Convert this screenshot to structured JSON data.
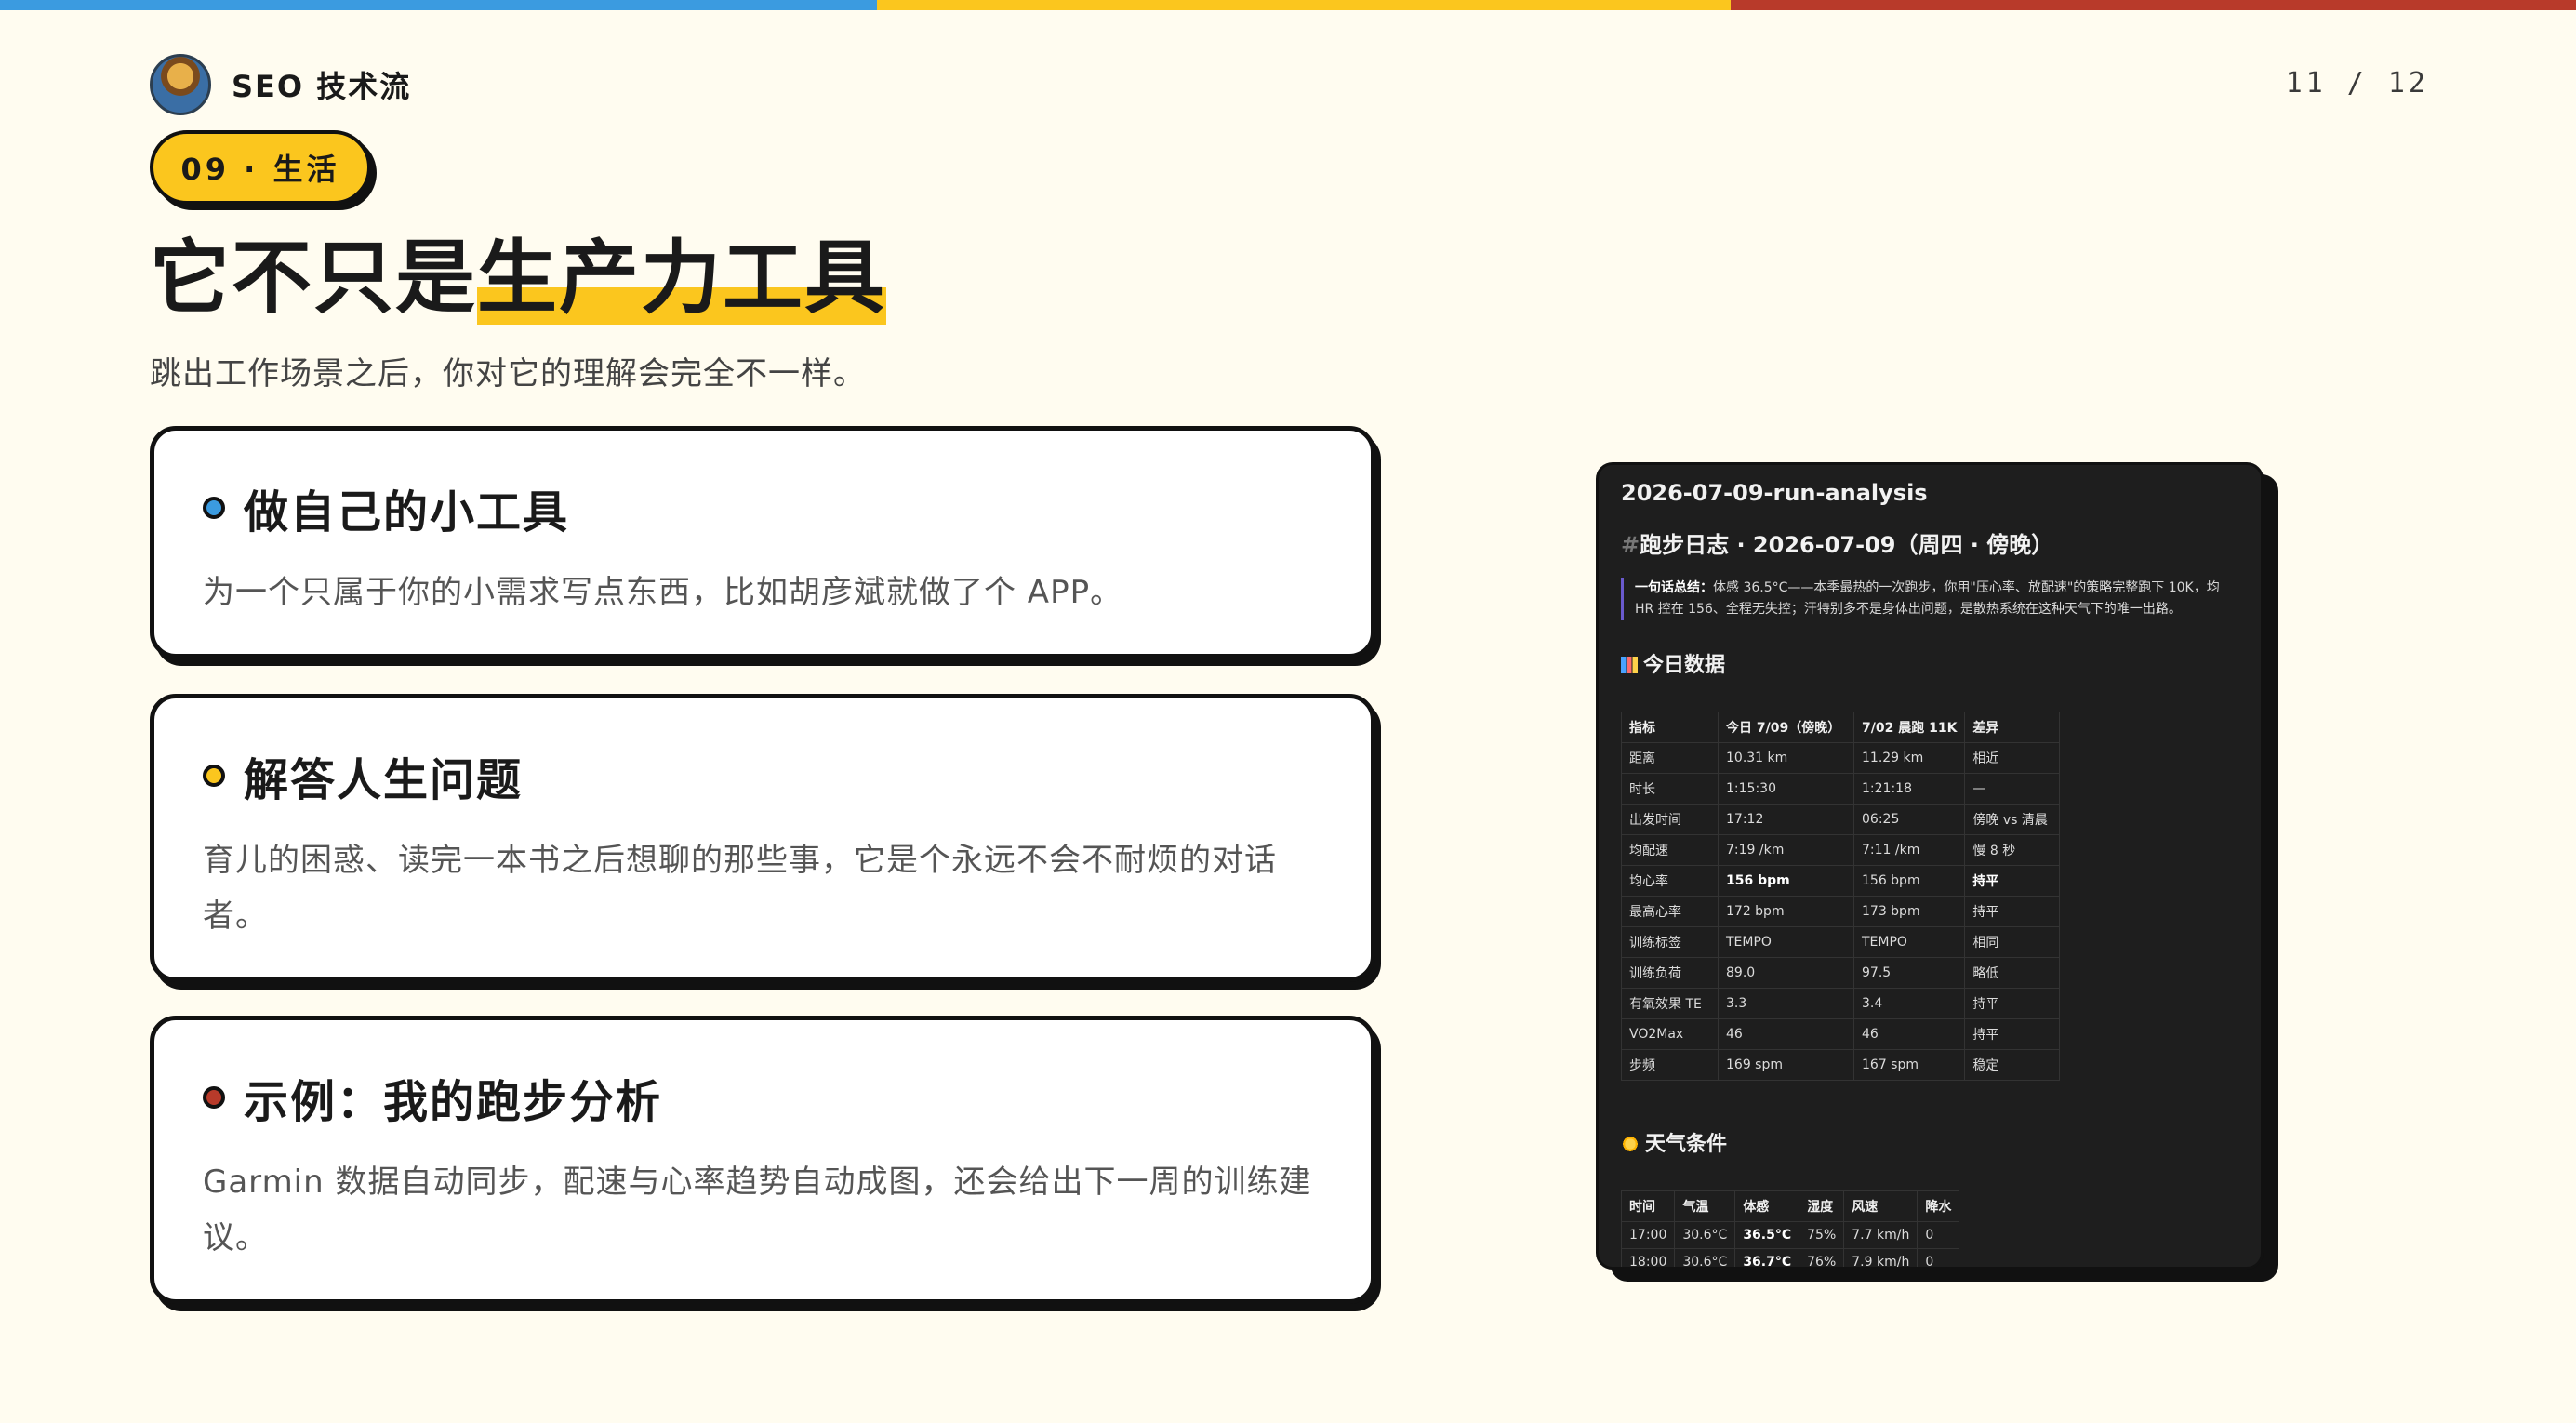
{
  "top_bar_colors": [
    "#3b9be0",
    "#fbc61e",
    "#b83a2a"
  ],
  "brand": {
    "name": "SEO 技术流",
    "avatar": "avatar"
  },
  "pager": "11 / 12",
  "tag": "09 · 生活",
  "title": {
    "before": "它不只是",
    "highlight": "生产力工具"
  },
  "subtitle": "跳出工作场景之后，你对它的理解会完全不一样。",
  "cards": [
    {
      "title": "做自己的小工具",
      "desc": "为一个只属于你的小需求写点东西，比如胡彦斌就做了个 APP。",
      "dot_color": "#3b9be0"
    },
    {
      "title": "解答人生问题",
      "desc": "育儿的困惑、读完一本书之后想聊的那些事，它是个永远不会不耐烦的对话者。",
      "dot_color": "#fbc61e"
    },
    {
      "title": "示例：我的跑步分析",
      "desc": "Garmin 数据自动同步，配速与心率趋势自动成图，还会给出下一周的训练建议。",
      "dot_color": "#b83a2a"
    }
  ],
  "screenshot": {
    "doc_title": "2026-07-09-run-analysis",
    "h1": "跑步日志 · 2026-07-09（周四 · 傍晚）",
    "quote_label": "一句话总结：",
    "quote_text": "体感 36.5°C——本季最热的一次跑步，你用\"压心率、放配速\"的策略完整跑下 10K，均HR 控在 156、全程无失控；汗特别多不是身体出问题，是散热系统在这种天气下的唯一出路。",
    "section_data": "今日数据",
    "table1_headers": [
      "指标",
      "今日 7/09（傍晚）",
      "7/02 晨跑 11K",
      "差异"
    ],
    "table1_rows": [
      [
        "距离",
        "10.31 km",
        "11.29 km",
        "相近"
      ],
      [
        "时长",
        "1:15:30",
        "1:21:18",
        "—"
      ],
      [
        "出发时间",
        "17:12",
        "06:25",
        "傍晚 vs 清晨"
      ],
      [
        "均配速",
        "7:19 /km",
        "7:11 /km",
        "慢 8 秒"
      ],
      [
        "均心率",
        "156 bpm",
        "156 bpm",
        "持平"
      ],
      [
        "最高心率",
        "172 bpm",
        "173 bpm",
        "持平"
      ],
      [
        "训练标签",
        "TEMPO",
        "TEMPO",
        "相同"
      ],
      [
        "训练负荷",
        "89.0",
        "97.5",
        "略低"
      ],
      [
        "有氧效果 TE",
        "3.3",
        "3.4",
        "持平"
      ],
      [
        "VO2Max",
        "46",
        "46",
        "持平"
      ],
      [
        "步频",
        "169 spm",
        "167 spm",
        "稳定"
      ]
    ],
    "section_weather": "天气条件",
    "table2_headers": [
      "时间",
      "气温",
      "体感",
      "湿度",
      "风速",
      "降水"
    ],
    "table2_rows": [
      [
        "17:00",
        "30.6°C",
        "36.5°C",
        "75%",
        "7.7 km/h",
        "0"
      ],
      [
        "18:00",
        "30.6°C",
        "36.7°C",
        "76%",
        "7.9 km/h",
        "0"
      ]
    ]
  }
}
